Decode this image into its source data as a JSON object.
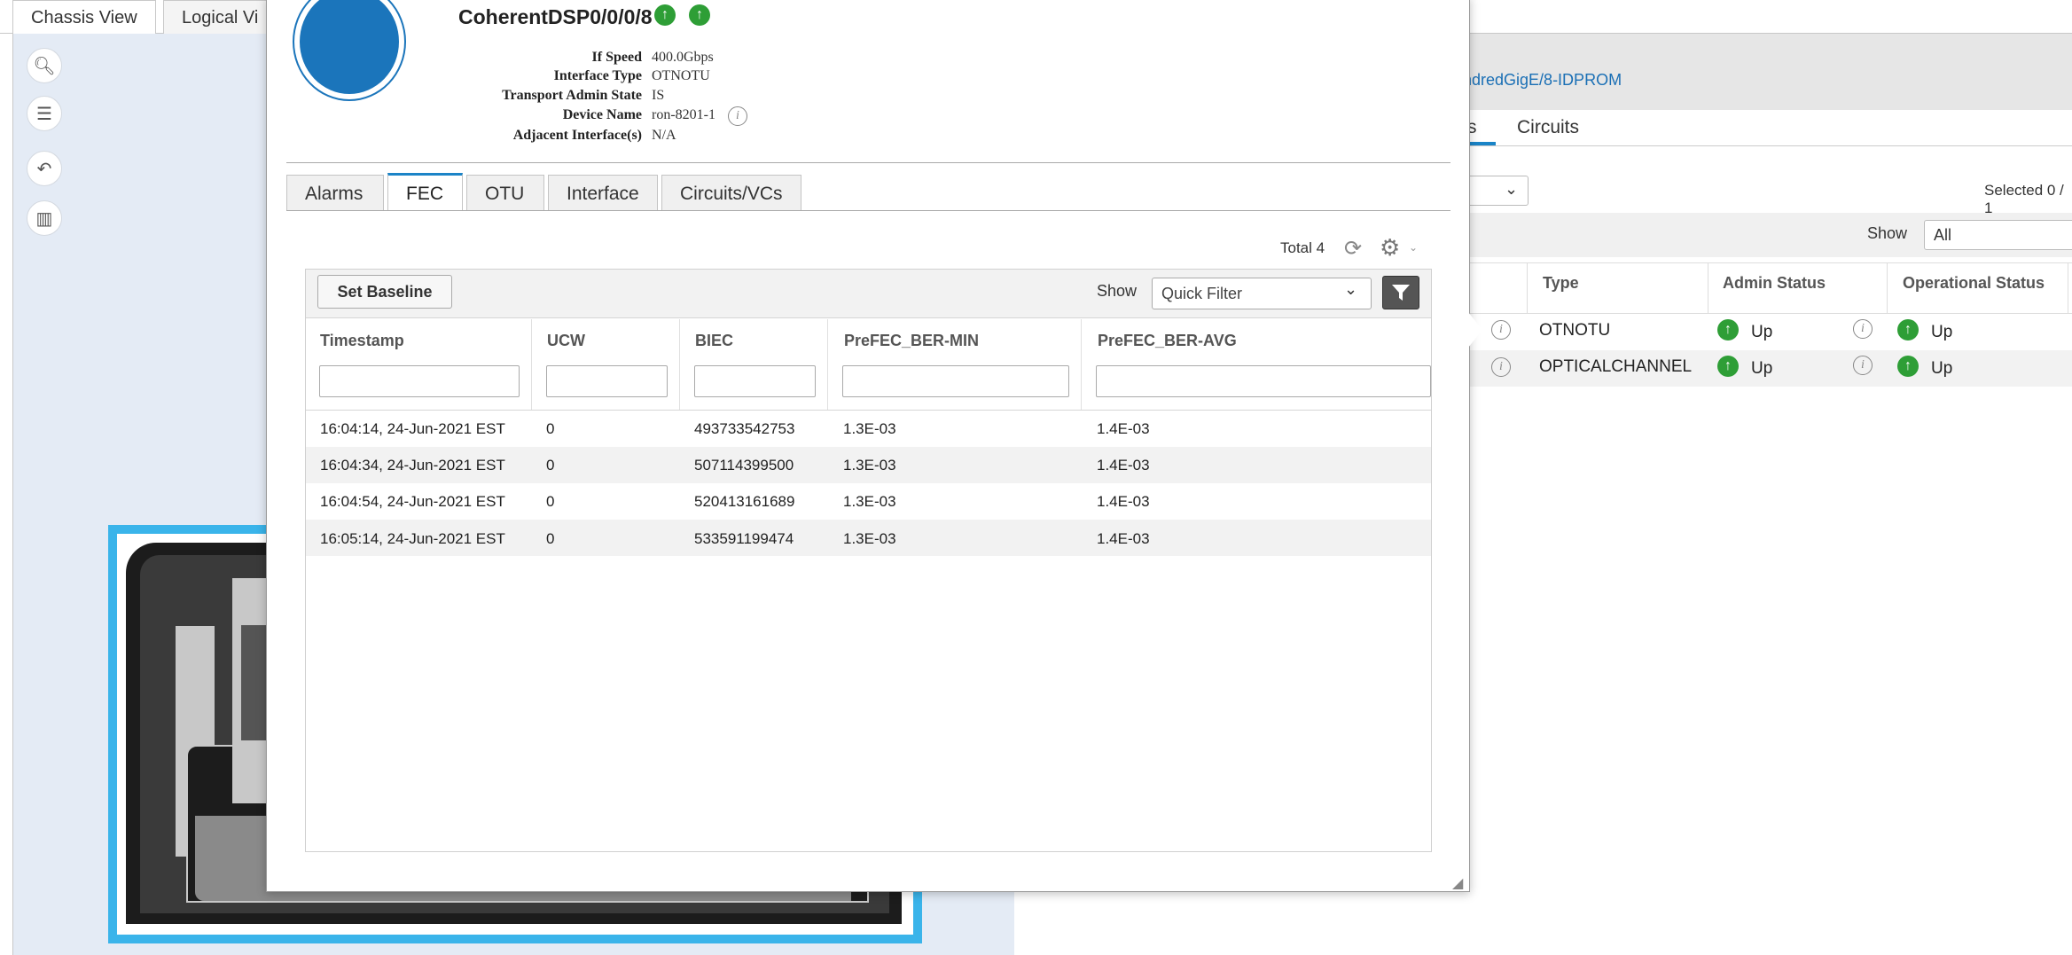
{
  "background_app": {
    "tabs": [
      {
        "label": "Chassis View",
        "active": true
      },
      {
        "label": "Logical Vi",
        "active": false
      }
    ],
    "idprom_link": "ndredGigE/8-IDPROM",
    "right_tabs": [
      "s",
      "Circuits"
    ],
    "selected_text": "Selected 0 / 1",
    "show_label": "Show",
    "show_value": "All",
    "columns": [
      "Type",
      "Admin Status",
      "Operational Status"
    ],
    "rows": [
      {
        "type": "OTNOTU",
        "admin_status": "Up",
        "oper_status": "Up"
      },
      {
        "type": "OPTICALCHANNEL",
        "admin_status": "Up",
        "oper_status": "Up"
      }
    ]
  },
  "popup": {
    "title": "CoherentDSP0/0/0/8",
    "properties": [
      {
        "label": "If Speed",
        "value": "400.0Gbps"
      },
      {
        "label": "Interface Type",
        "value": "OTNOTU"
      },
      {
        "label": "Transport Admin State",
        "value": "IS"
      },
      {
        "label": "Device Name",
        "value": "ron-8201-1"
      },
      {
        "label": "Adjacent Interface(s)",
        "value": "N/A"
      }
    ],
    "tabs": [
      "Alarms",
      "FEC",
      "OTU",
      "Interface",
      "Circuits/VCs"
    ],
    "active_tab": "FEC",
    "total_label": "Total 4",
    "set_baseline_label": "Set Baseline",
    "show_label": "Show",
    "quick_filter_value": "Quick Filter",
    "table": {
      "columns": [
        "Timestamp",
        "UCW",
        "BIEC",
        "PreFEC_BER-MIN",
        "PreFEC_BER-AVG"
      ],
      "rows": [
        [
          "16:04:14, 24-Jun-2021 EST",
          "0",
          "493733542753",
          "1.3E-03",
          "1.4E-03"
        ],
        [
          "16:04:34, 24-Jun-2021 EST",
          "0",
          "507114399500",
          "1.3E-03",
          "1.4E-03"
        ],
        [
          "16:04:54, 24-Jun-2021 EST",
          "0",
          "520413161689",
          "1.3E-03",
          "1.4E-03"
        ],
        [
          "16:05:14, 24-Jun-2021 EST",
          "0",
          "533591199474",
          "1.3E-03",
          "1.4E-03"
        ]
      ]
    }
  },
  "colors": {
    "accent_blue": "#1b75bb",
    "status_green": "#2e9e36",
    "chassis_border": "#3ab4ea"
  }
}
